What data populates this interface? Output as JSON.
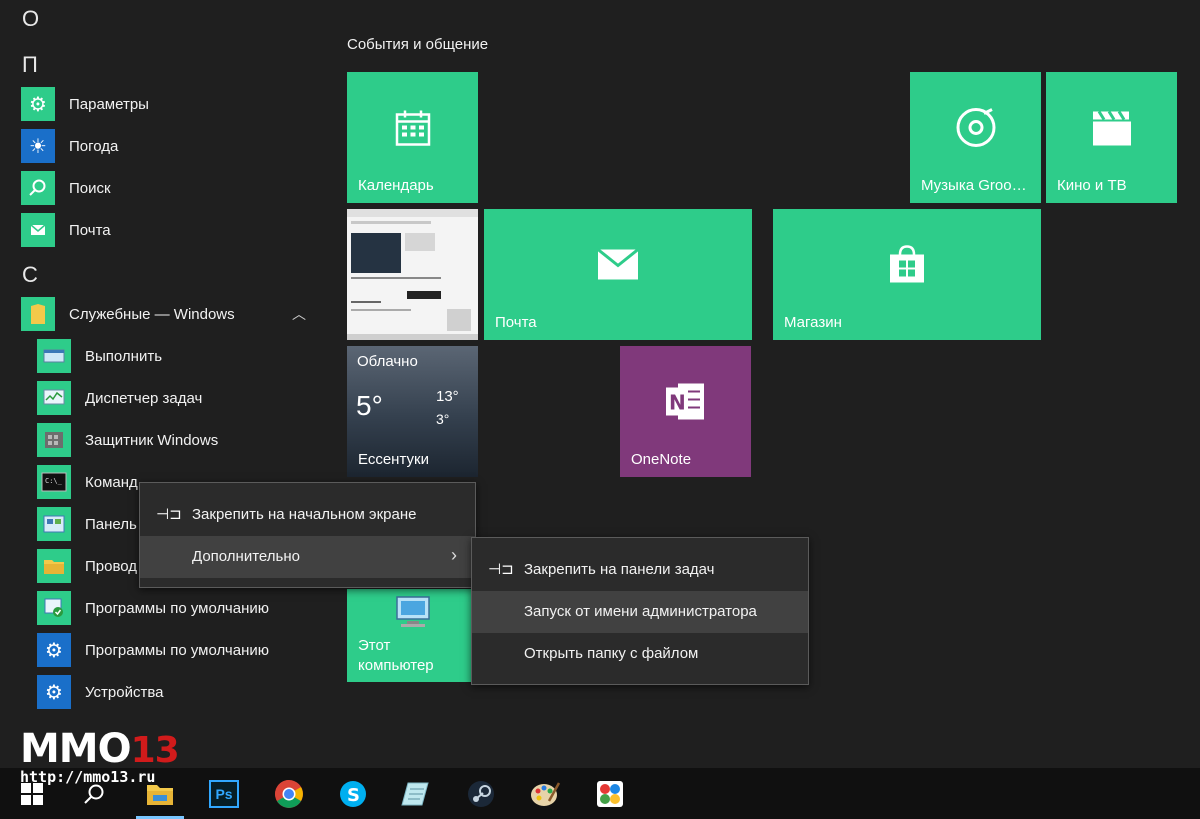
{
  "app_list": {
    "letters": [
      "О",
      "П",
      "С"
    ],
    "items": [
      {
        "label": "Параметры",
        "icon": "gear-icon",
        "color": "#2ecc8a"
      },
      {
        "label": "Погода",
        "icon": "sun-icon",
        "color": "#1a6fc9"
      },
      {
        "label": "Поиск",
        "icon": "search-icon",
        "color": "#2ecc8a"
      },
      {
        "label": "Почта",
        "icon": "mail-icon",
        "color": "#2ecc8a"
      },
      {
        "label": "Служебные — Windows",
        "icon": "folder-icon",
        "color": "#2ecc8a"
      },
      {
        "label": "Выполнить",
        "icon": "run-icon",
        "color": "#2ecc8a"
      },
      {
        "label": "Диспетчер задач",
        "icon": "task-manager-icon",
        "color": "#2ecc8a"
      },
      {
        "label": "Защитник Windows",
        "icon": "defender-icon",
        "color": "#2ecc8a"
      },
      {
        "label": "Команд",
        "icon": "cmd-icon",
        "color": "#2ecc8a"
      },
      {
        "label": "Панель",
        "icon": "control-panel-icon",
        "color": "#2ecc8a"
      },
      {
        "label": "Провод",
        "icon": "explorer-icon",
        "color": "#2ecc8a"
      },
      {
        "label": "Программы по умолчанию",
        "icon": "default-programs-icon",
        "color": "#2ecc8a"
      },
      {
        "label": "Программы по умолчанию",
        "icon": "gear-icon",
        "color": "#1a6fc9"
      },
      {
        "label": "Устройства",
        "icon": "gear-icon",
        "color": "#1a6fc9"
      }
    ]
  },
  "tiles": {
    "group_title": "События и общение",
    "calendar": "Календарь",
    "groove": "Музыка Groo…",
    "movies": "Кино и ТВ",
    "mail": "Почта",
    "store": "Магазин",
    "weather": {
      "condition": "Облачно",
      "temp": "5°",
      "high": "13°",
      "low": "3°",
      "city": "Ессентуки"
    },
    "onenote": "OneNote",
    "computer": "Этот компьютер",
    "accent": "#2ecc8a",
    "onenote_color": "#80397b"
  },
  "context_menu": {
    "pin_start": "Закрепить на начальном экране",
    "more": "Дополнительно"
  },
  "submenu": {
    "pin_taskbar": "Закрепить на панели задач",
    "run_admin": "Запуск от имени администратора",
    "open_folder": "Открыть папку с файлом"
  },
  "watermark": {
    "brand": "MMO",
    "brand_num": "13",
    "url": "http://mmo13.ru"
  },
  "taskbar": {
    "items": [
      "start-icon",
      "search-icon",
      "file-explorer-icon",
      "photoshop-icon",
      "chrome-icon",
      "skype-icon",
      "notepad-icon",
      "steam-icon",
      "paint-icon",
      "app-icon"
    ],
    "ps_label": "Ps"
  }
}
